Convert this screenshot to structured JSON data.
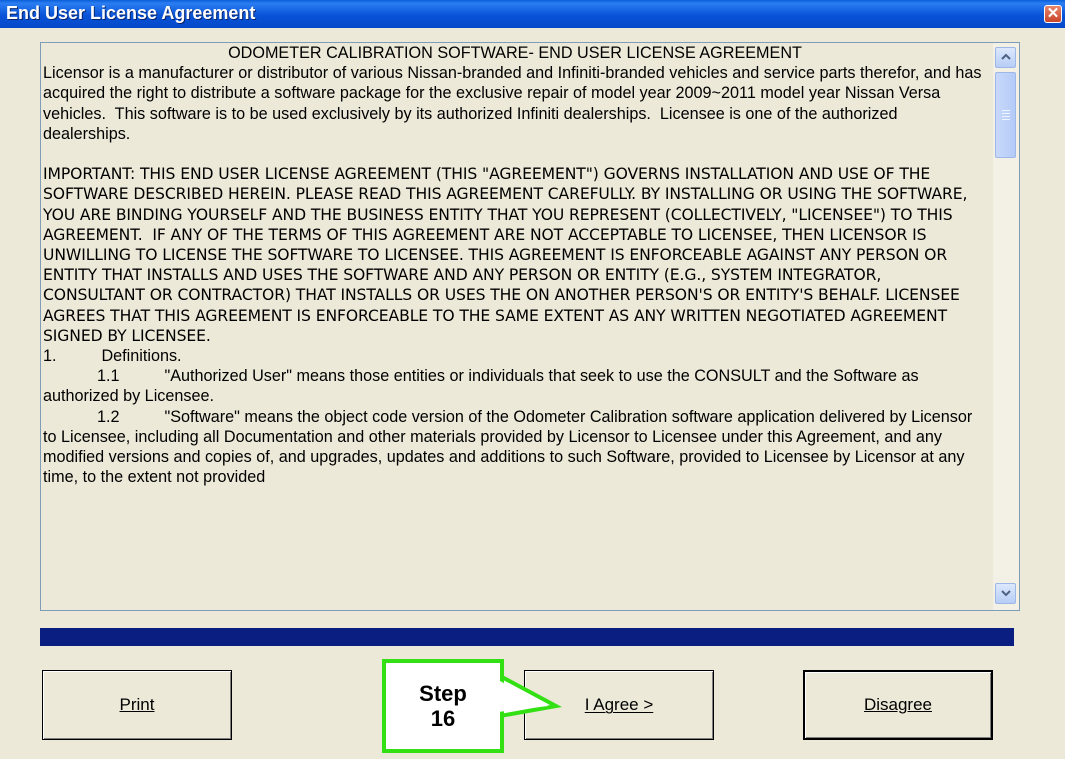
{
  "window": {
    "title": "End User License Agreement",
    "close_glyph": "✕"
  },
  "license": {
    "heading": "ODOMETER CALIBRATION SOFTWARE- END USER LICENSE AGREEMENT",
    "para1": "Licensor is a manufacturer or distributor of various Nissan-branded and Infiniti-branded vehicles and service parts therefor, and has acquired the right to distribute a software package for the exclusive repair of model year 2009~2011 model year Nissan Versa vehicles.  This software is to be used exclusively by its authorized Infiniti dealerships.  Licensee is one of the authorized dealerships.",
    "para2": "IMPORTANT: THIS END USER LICENSE AGREEMENT (THIS \"AGREEMENT\") GOVERNS INSTALLATION AND USE OF THE SOFTWARE DESCRIBED HEREIN. PLEASE READ THIS AGREEMENT CAREFULLY. BY INSTALLING OR USING THE SOFTWARE, YOU ARE BINDING YOURSELF AND THE BUSINESS ENTITY THAT YOU REPRESENT (COLLECTIVELY, \"LICENSEE\") TO THIS AGREEMENT.  IF ANY OF THE TERMS OF THIS AGREEMENT ARE NOT ACCEPTABLE TO LICENSEE, THEN LICENSOR IS UNWILLING TO LICENSE THE SOFTWARE TO LICENSEE. THIS AGREEMENT IS ENFORCEABLE AGAINST ANY PERSON OR ENTITY THAT INSTALLS AND USES THE SOFTWARE AND ANY PERSON OR ENTITY (E.G., SYSTEM INTEGRATOR, CONSULTANT OR CONTRACTOR) THAT INSTALLS OR USES THE ON ANOTHER PERSON'S OR ENTITY'S BEHALF. LICENSEE AGREES THAT THIS AGREEMENT IS ENFORCEABLE TO THE SAME EXTENT AS ANY WRITTEN NEGOTIATED AGREEMENT SIGNED BY LICENSEE.",
    "section1": "1.          Definitions.",
    "s1_1": "            1.1          \"Authorized User\" means those entities or individuals that seek to use the CONSULT and the Software as authorized by Licensee.",
    "s1_2": "            1.2          \"Software\" means the object code version of the Odometer Calibration software application delivered by Licensor to Licensee, including all Documentation and other materials provided by Licensor to Licensee under this Agreement, and any modified versions and copies of, and upgrades, updates and additions to such Software, provided to Licensee by Licensor at any time, to the extent not provided"
  },
  "buttons": {
    "print_label": "Print",
    "agree_label": "I Agree >",
    "disagree_label": "Disagree"
  },
  "callout": {
    "line1": "Step",
    "line2": "16"
  },
  "colors": {
    "callout_border": "#33e014",
    "progress_fill": "#0a1e82",
    "titlebar": "#0853d8"
  },
  "progress": {
    "fraction": 1.0
  }
}
